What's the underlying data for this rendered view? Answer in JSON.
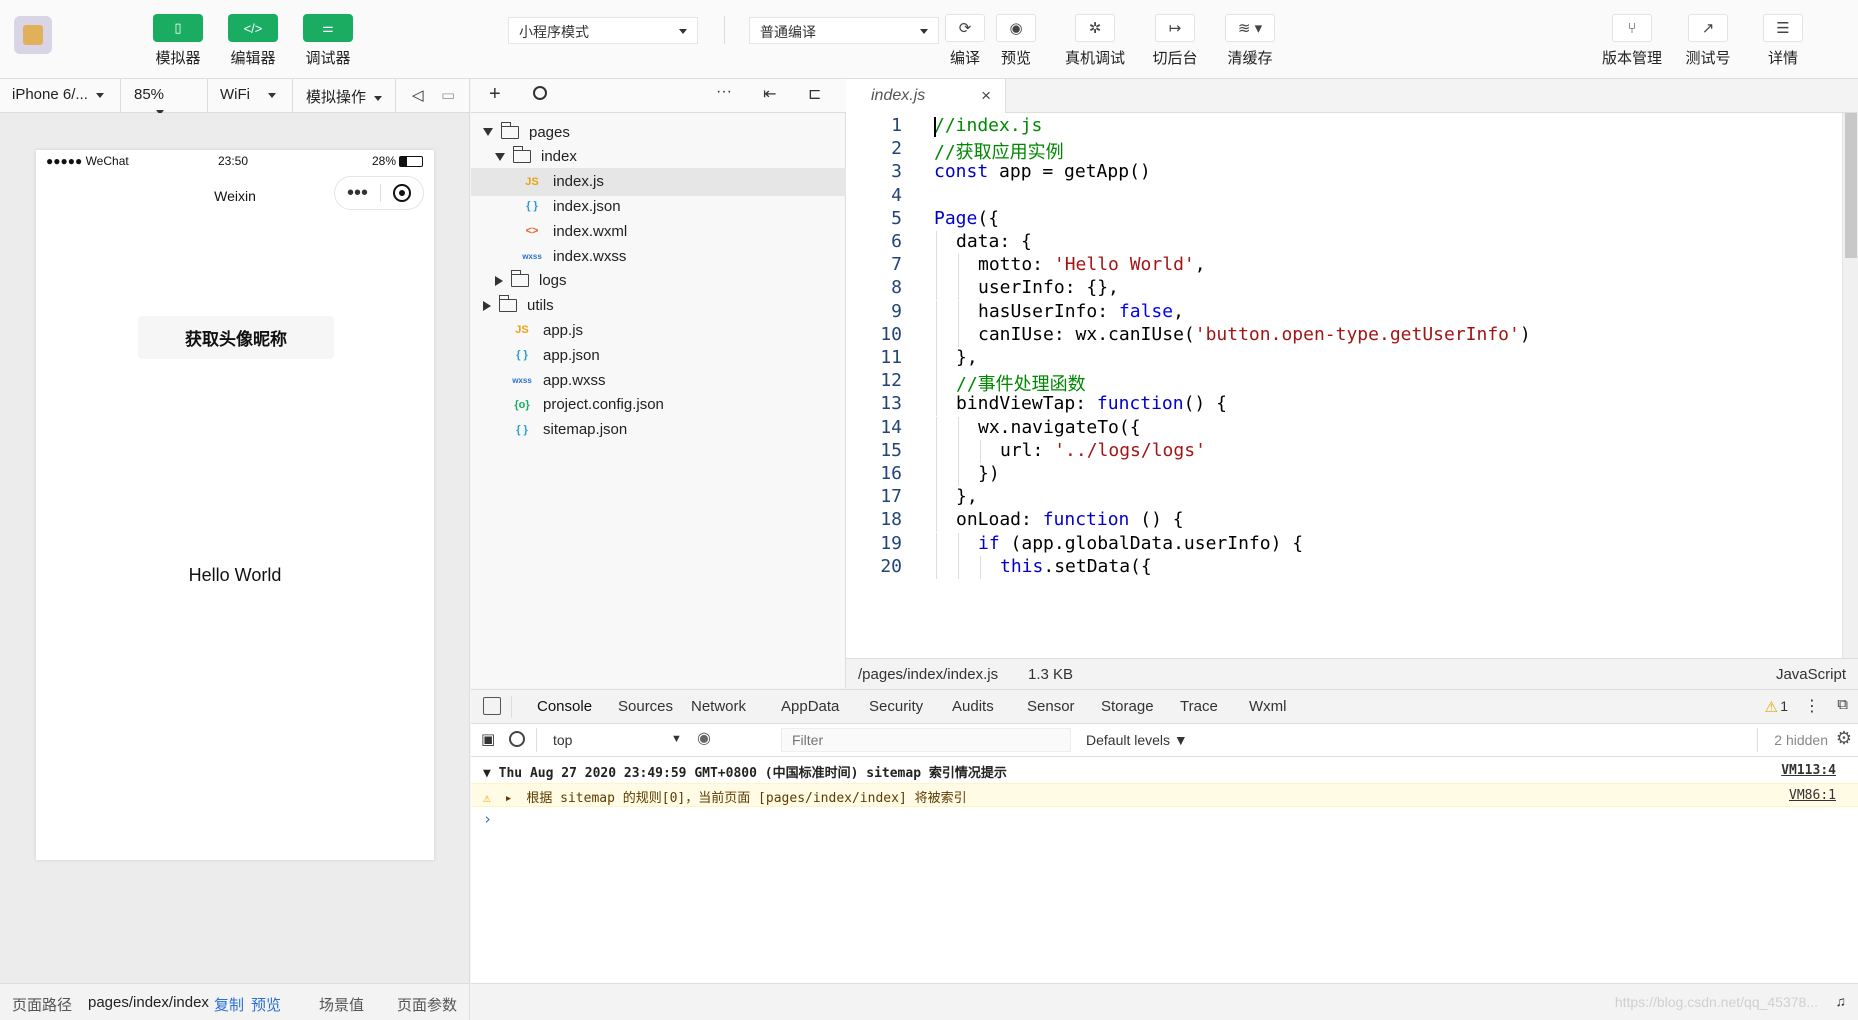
{
  "toolbar": {
    "simulator": "模拟器",
    "editor": "编辑器",
    "debugger": "调试器",
    "mode": "小程序模式",
    "compile_mode": "普通编译",
    "compile": "编译",
    "preview": "预览",
    "remote_debug": "真机调试",
    "background": "切后台",
    "clear_cache": "清缓存",
    "version": "版本管理",
    "test_account": "测试号",
    "details": "详情",
    "accent": "#1aad62"
  },
  "sim_bar": {
    "device": "iPhone 6/...",
    "zoom": "85%",
    "network": "WiFi",
    "operation": "模拟操作"
  },
  "phone": {
    "signal": "●●●●● WeChat",
    "time": "23:50",
    "battery": "28%",
    "nav_title": "Weixin",
    "button": "获取头像昵称",
    "motto": "Hello World"
  },
  "status_bar": {
    "label": "页面路径",
    "path": "pages/index/index",
    "copy": "复制",
    "preview": "预览",
    "scene": "场景值",
    "params": "页面参数"
  },
  "file_tree": [
    {
      "name": "pages",
      "type": "folder",
      "open": true,
      "indent": 0
    },
    {
      "name": "index",
      "type": "folder",
      "open": true,
      "indent": 1
    },
    {
      "name": "index.js",
      "type": "js",
      "indent": 2,
      "active": true
    },
    {
      "name": "index.json",
      "type": "json",
      "indent": 2
    },
    {
      "name": "index.wxml",
      "type": "wxml",
      "indent": 2
    },
    {
      "name": "index.wxss",
      "type": "wxss",
      "indent": 2
    },
    {
      "name": "logs",
      "type": "folder",
      "open": false,
      "indent": 1
    },
    {
      "name": "utils",
      "type": "folder",
      "open": false,
      "indent": 0
    },
    {
      "name": "app.js",
      "type": "js",
      "indent": 1
    },
    {
      "name": "app.json",
      "type": "json",
      "indent": 1
    },
    {
      "name": "app.wxss",
      "type": "wxss",
      "indent": 1
    },
    {
      "name": "project.config.json",
      "type": "config",
      "indent": 1
    },
    {
      "name": "sitemap.json",
      "type": "json",
      "indent": 1
    }
  ],
  "editor": {
    "tab": "index.js",
    "lines": [
      {
        "n": "1",
        "indent": 0,
        "html": "<span class='cm'>//index.js</span>"
      },
      {
        "n": "2",
        "indent": 0,
        "html": "<span class='cm'>//获取应用实例</span>"
      },
      {
        "n": "3",
        "indent": 0,
        "html": "<span class='kw'>const</span> app = getApp()"
      },
      {
        "n": "4",
        "indent": 0,
        "html": ""
      },
      {
        "n": "5",
        "indent": 0,
        "html": "<span class='kw'>Page</span>({"
      },
      {
        "n": "6",
        "indent": 1,
        "html": "data: {"
      },
      {
        "n": "7",
        "indent": 2,
        "html": "motto: <span class='str'>'Hello World'</span>,"
      },
      {
        "n": "8",
        "indent": 2,
        "html": "userInfo: {},"
      },
      {
        "n": "9",
        "indent": 2,
        "html": "hasUserInfo: <span class='bl'>false</span>,"
      },
      {
        "n": "10",
        "indent": 2,
        "html": "canIUse: wx.canIUse(<span class='str'>'button.open-type.getUserInfo'</span>)"
      },
      {
        "n": "11",
        "indent": 1,
        "html": "},"
      },
      {
        "n": "12",
        "indent": 1,
        "html": "<span class='cm'>//事件处理函数</span>"
      },
      {
        "n": "13",
        "indent": 1,
        "html": "bindViewTap: <span class='kw'>function</span>() {"
      },
      {
        "n": "14",
        "indent": 2,
        "html": "wx.navigateTo({"
      },
      {
        "n": "15",
        "indent": 3,
        "html": "url: <span class='str'>'../logs/logs'</span>"
      },
      {
        "n": "16",
        "indent": 2,
        "html": "})"
      },
      {
        "n": "17",
        "indent": 1,
        "html": "},"
      },
      {
        "n": "18",
        "indent": 1,
        "html": "onLoad: <span class='kw'>function</span> () {"
      },
      {
        "n": "19",
        "indent": 2,
        "html": "<span class='kw'>if</span> (app.globalData.userInfo) {"
      },
      {
        "n": "20",
        "indent": 3,
        "html": "<span class='kw'>this</span>.setData({"
      }
    ],
    "file_path": "/pages/index/index.js",
    "file_size": "1.3 KB",
    "language": "JavaScript"
  },
  "devtools": {
    "tabs": [
      "Console",
      "Sources",
      "Network",
      "AppData",
      "Security",
      "Audits",
      "Sensor",
      "Storage",
      "Trace",
      "Wxml"
    ],
    "active_tab": "Console",
    "warn_count": "1",
    "context": "top",
    "filter_placeholder": "Filter",
    "levels": "Default levels ▼",
    "hidden": "2 hidden",
    "logs": [
      {
        "text": "▼ Thu Aug 27 2020 23:49:59 GMT+0800 (中国标准时间) sitemap 索引情况提示",
        "link": "VM113:4",
        "level": "group"
      },
      {
        "text": "根据 sitemap 的规则[0]，当前页面 [pages/index/index] 将被索引",
        "link": "VM86:1",
        "level": "warn"
      }
    ],
    "prompt": "›"
  },
  "watermark": "https://blog.csdn.net/qq_45378..."
}
